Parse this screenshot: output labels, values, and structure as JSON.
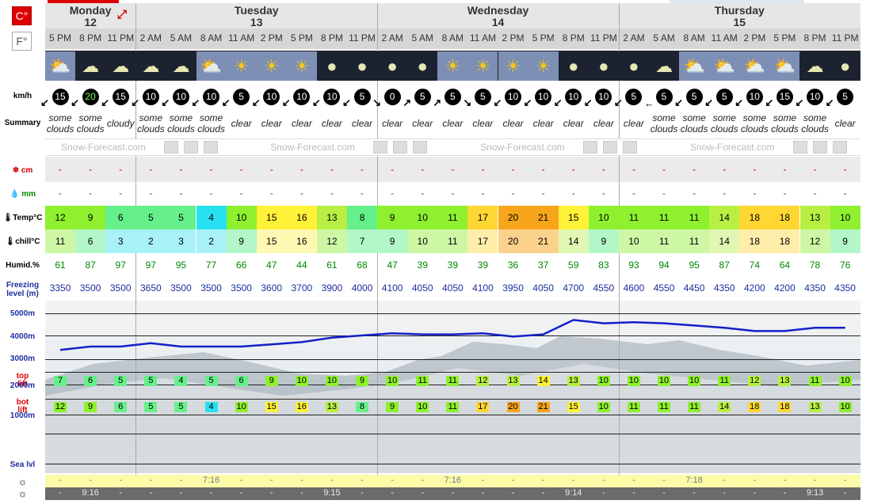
{
  "units": {
    "celsius": "C°",
    "fahrenheit": "F°"
  },
  "row_labels": {
    "wind": "km/h",
    "summary": "Summary",
    "snow": "cm",
    "rain": "mm",
    "temp": "Temp°C",
    "chill": "chill°C",
    "humid": "Humid.%",
    "freezing1": "Freezing",
    "freezing2": "level (m)",
    "alt5000": "5000m",
    "alt4000": "4000m",
    "alt3000": "3000m",
    "alt2000": "2000m",
    "alt1000": "1000m",
    "sealvl": "Sea lvl",
    "top": "top",
    "toplift": "lift",
    "bot": "bot",
    "botlift": "lift"
  },
  "days": [
    {
      "name": "Monday",
      "date": "12"
    },
    {
      "name": "Tuesday",
      "date": "13"
    },
    {
      "name": "Wednesday",
      "date": "14"
    },
    {
      "name": "Thursday",
      "date": "15"
    }
  ],
  "brand": "Snow-Forecast.com",
  "times": [
    "5 PM",
    "8 PM",
    "11 PM",
    "2 AM",
    "5 AM",
    "8 AM",
    "11 AM",
    "2 PM",
    "5 PM",
    "8 PM",
    "11 PM",
    "2 AM",
    "5 AM",
    "8 AM",
    "11 AM",
    "2 PM",
    "5 PM",
    "8 PM",
    "11 PM",
    "2 AM",
    "5 AM",
    "8 AM",
    "11 AM",
    "2 PM",
    "5 PM",
    "8 PM",
    "11 PM"
  ],
  "icons": [
    "sun-cloud-icon",
    "moon-cloud-icon",
    "cloud-moon-icon",
    "moon-cloud-icon",
    "moon-cloud-icon",
    "sun-cloud-icon",
    "sun-icon",
    "sun-icon",
    "sun-icon",
    "moon-icon",
    "moon-icon",
    "moon-icon",
    "moon-icon",
    "sun-icon",
    "sun-icon",
    "sun-icon",
    "sun-icon",
    "moon-icon",
    "moon-icon",
    "moon-icon",
    "moon-cloud-icon",
    "sun-cloud-icon",
    "sun-cloud-icon",
    "sun-cloud-icon",
    "sun-cloud-icon",
    "moon-cloud-icon",
    "moon-icon"
  ],
  "wind": [
    "15",
    "20",
    "15",
    "10",
    "10",
    "10",
    "5",
    "10",
    "10",
    "10",
    "5",
    "0",
    "5",
    "5",
    "5",
    "10",
    "10",
    "10",
    "10",
    "5",
    "5",
    "5",
    "5",
    "10",
    "15",
    "10",
    "5"
  ],
  "summary": [
    "some clouds",
    "some clouds",
    "cloudy",
    "some clouds",
    "some clouds",
    "some clouds",
    "clear",
    "clear",
    "clear",
    "clear",
    "clear",
    "clear",
    "clear",
    "clear",
    "clear",
    "clear",
    "clear",
    "clear",
    "clear",
    "clear",
    "some clouds",
    "some clouds",
    "some clouds",
    "some clouds",
    "some clouds",
    "some clouds",
    "clear"
  ],
  "snow": [
    "-",
    "-",
    "-",
    "-",
    "-",
    "-",
    "-",
    "-",
    "-",
    "-",
    "-",
    "-",
    "-",
    "-",
    "-",
    "-",
    "-",
    "-",
    "-",
    "-",
    "-",
    "-",
    "-",
    "-",
    "-",
    "-",
    "-"
  ],
  "rain": [
    "-",
    "-",
    "-",
    "-",
    "-",
    "-",
    "-",
    "-",
    "-",
    "-",
    "-",
    "-",
    "-",
    "-",
    "-",
    "-",
    "-",
    "-",
    "-",
    "-",
    "-",
    "-",
    "-",
    "-",
    "-",
    "-",
    "-"
  ],
  "temp": [
    "12",
    "9",
    "6",
    "5",
    "5",
    "4",
    "10",
    "15",
    "16",
    "13",
    "8",
    "9",
    "10",
    "11",
    "17",
    "20",
    "21",
    "15",
    "10",
    "11",
    "11",
    "11",
    "14",
    "18",
    "18",
    "13",
    "10"
  ],
  "chill": [
    "11",
    "6",
    "3",
    "2",
    "3",
    "2",
    "9",
    "15",
    "16",
    "12",
    "7",
    "9",
    "10",
    "11",
    "17",
    "20",
    "21",
    "14",
    "9",
    "10",
    "11",
    "11",
    "14",
    "18",
    "18",
    "12",
    "9"
  ],
  "humid": [
    "61",
    "87",
    "97",
    "97",
    "95",
    "77",
    "66",
    "47",
    "44",
    "61",
    "68",
    "47",
    "39",
    "39",
    "39",
    "36",
    "37",
    "59",
    "83",
    "93",
    "94",
    "95",
    "87",
    "74",
    "64",
    "78",
    "76"
  ],
  "freezing": [
    "3350",
    "3500",
    "3500",
    "3650",
    "3500",
    "3500",
    "3500",
    "3600",
    "3700",
    "3900",
    "4000",
    "4100",
    "4050",
    "4050",
    "4100",
    "3950",
    "4050",
    "4700",
    "4550",
    "4600",
    "4550",
    "4450",
    "4350",
    "4200",
    "4200",
    "4350",
    "4350"
  ],
  "top_lift": [
    "7",
    "6",
    "5",
    "5",
    "4",
    "5",
    "6",
    "9",
    "10",
    "10",
    "9",
    "10",
    "11",
    "11",
    "12",
    "13",
    "14",
    "13",
    "10",
    "10",
    "10",
    "10",
    "11",
    "12",
    "13",
    "11",
    "10"
  ],
  "bot_lift": [
    "12",
    "9",
    "6",
    "5",
    "5",
    "4",
    "10",
    "15",
    "16",
    "13",
    "8",
    "9",
    "10",
    "11",
    "17",
    "20",
    "21",
    "15",
    "10",
    "11",
    "11",
    "11",
    "14",
    "18",
    "18",
    "13",
    "10"
  ],
  "sunrise": [
    "-",
    "-",
    "-",
    "-",
    "-",
    "7:16",
    "-",
    "-",
    "-",
    "-",
    "-",
    "-",
    "-",
    "7:16",
    "-",
    "-",
    "-",
    "-",
    "-",
    "-",
    "-",
    "7:18",
    "-",
    "-",
    "-",
    "-",
    "-"
  ],
  "sunset": [
    "-",
    "9:16",
    "-",
    "-",
    "-",
    "-",
    "-",
    "-",
    "-",
    "9:15",
    "-",
    "-",
    "-",
    "-",
    "-",
    "-",
    "-",
    "9:14",
    "-",
    "-",
    "-",
    "-",
    "-",
    "-",
    "-",
    "9:13",
    "-"
  ]
}
